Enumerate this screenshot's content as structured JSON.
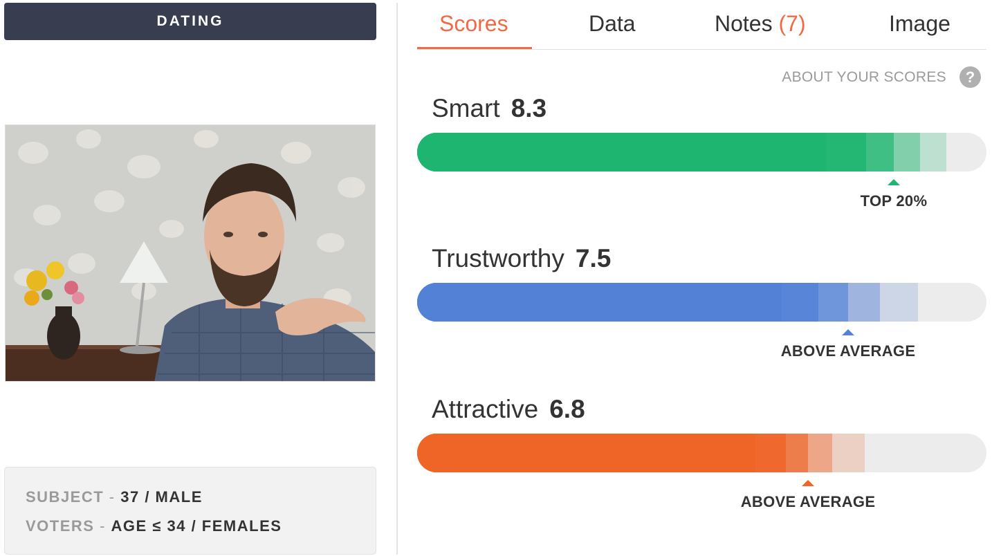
{
  "category": {
    "label": "DATING"
  },
  "tabs": [
    {
      "label": "Scores",
      "active": true
    },
    {
      "label": "Data",
      "active": false
    },
    {
      "label": "Notes",
      "count": "(7)",
      "active": false
    },
    {
      "label": "Image",
      "active": false
    }
  ],
  "about": {
    "label": "ABOUT YOUR SCORES",
    "help_glyph": "?"
  },
  "scores": [
    {
      "label": "Smart",
      "value": "8.3",
      "rank_label": "TOP 20%",
      "color": "#1db56f",
      "fill_fraction": 0.718
    },
    {
      "label": "Trustworthy",
      "value": "7.5",
      "rank_label": "ABOVE AVERAGE",
      "color": "#5381d6",
      "fill_fraction": 0.64
    },
    {
      "label": "Attractive",
      "value": "6.8",
      "rank_label": "ABOVE AVERAGE",
      "color": "#ef6427",
      "fill_fraction": 0.594
    }
  ],
  "info": {
    "subject_key": "SUBJECT",
    "subject_value": "37 / MALE",
    "voters_key": "VOTERS",
    "voters_value": "AGE ≤ 34 / FEMALES"
  },
  "photo": {
    "icon": "profile-photo"
  }
}
